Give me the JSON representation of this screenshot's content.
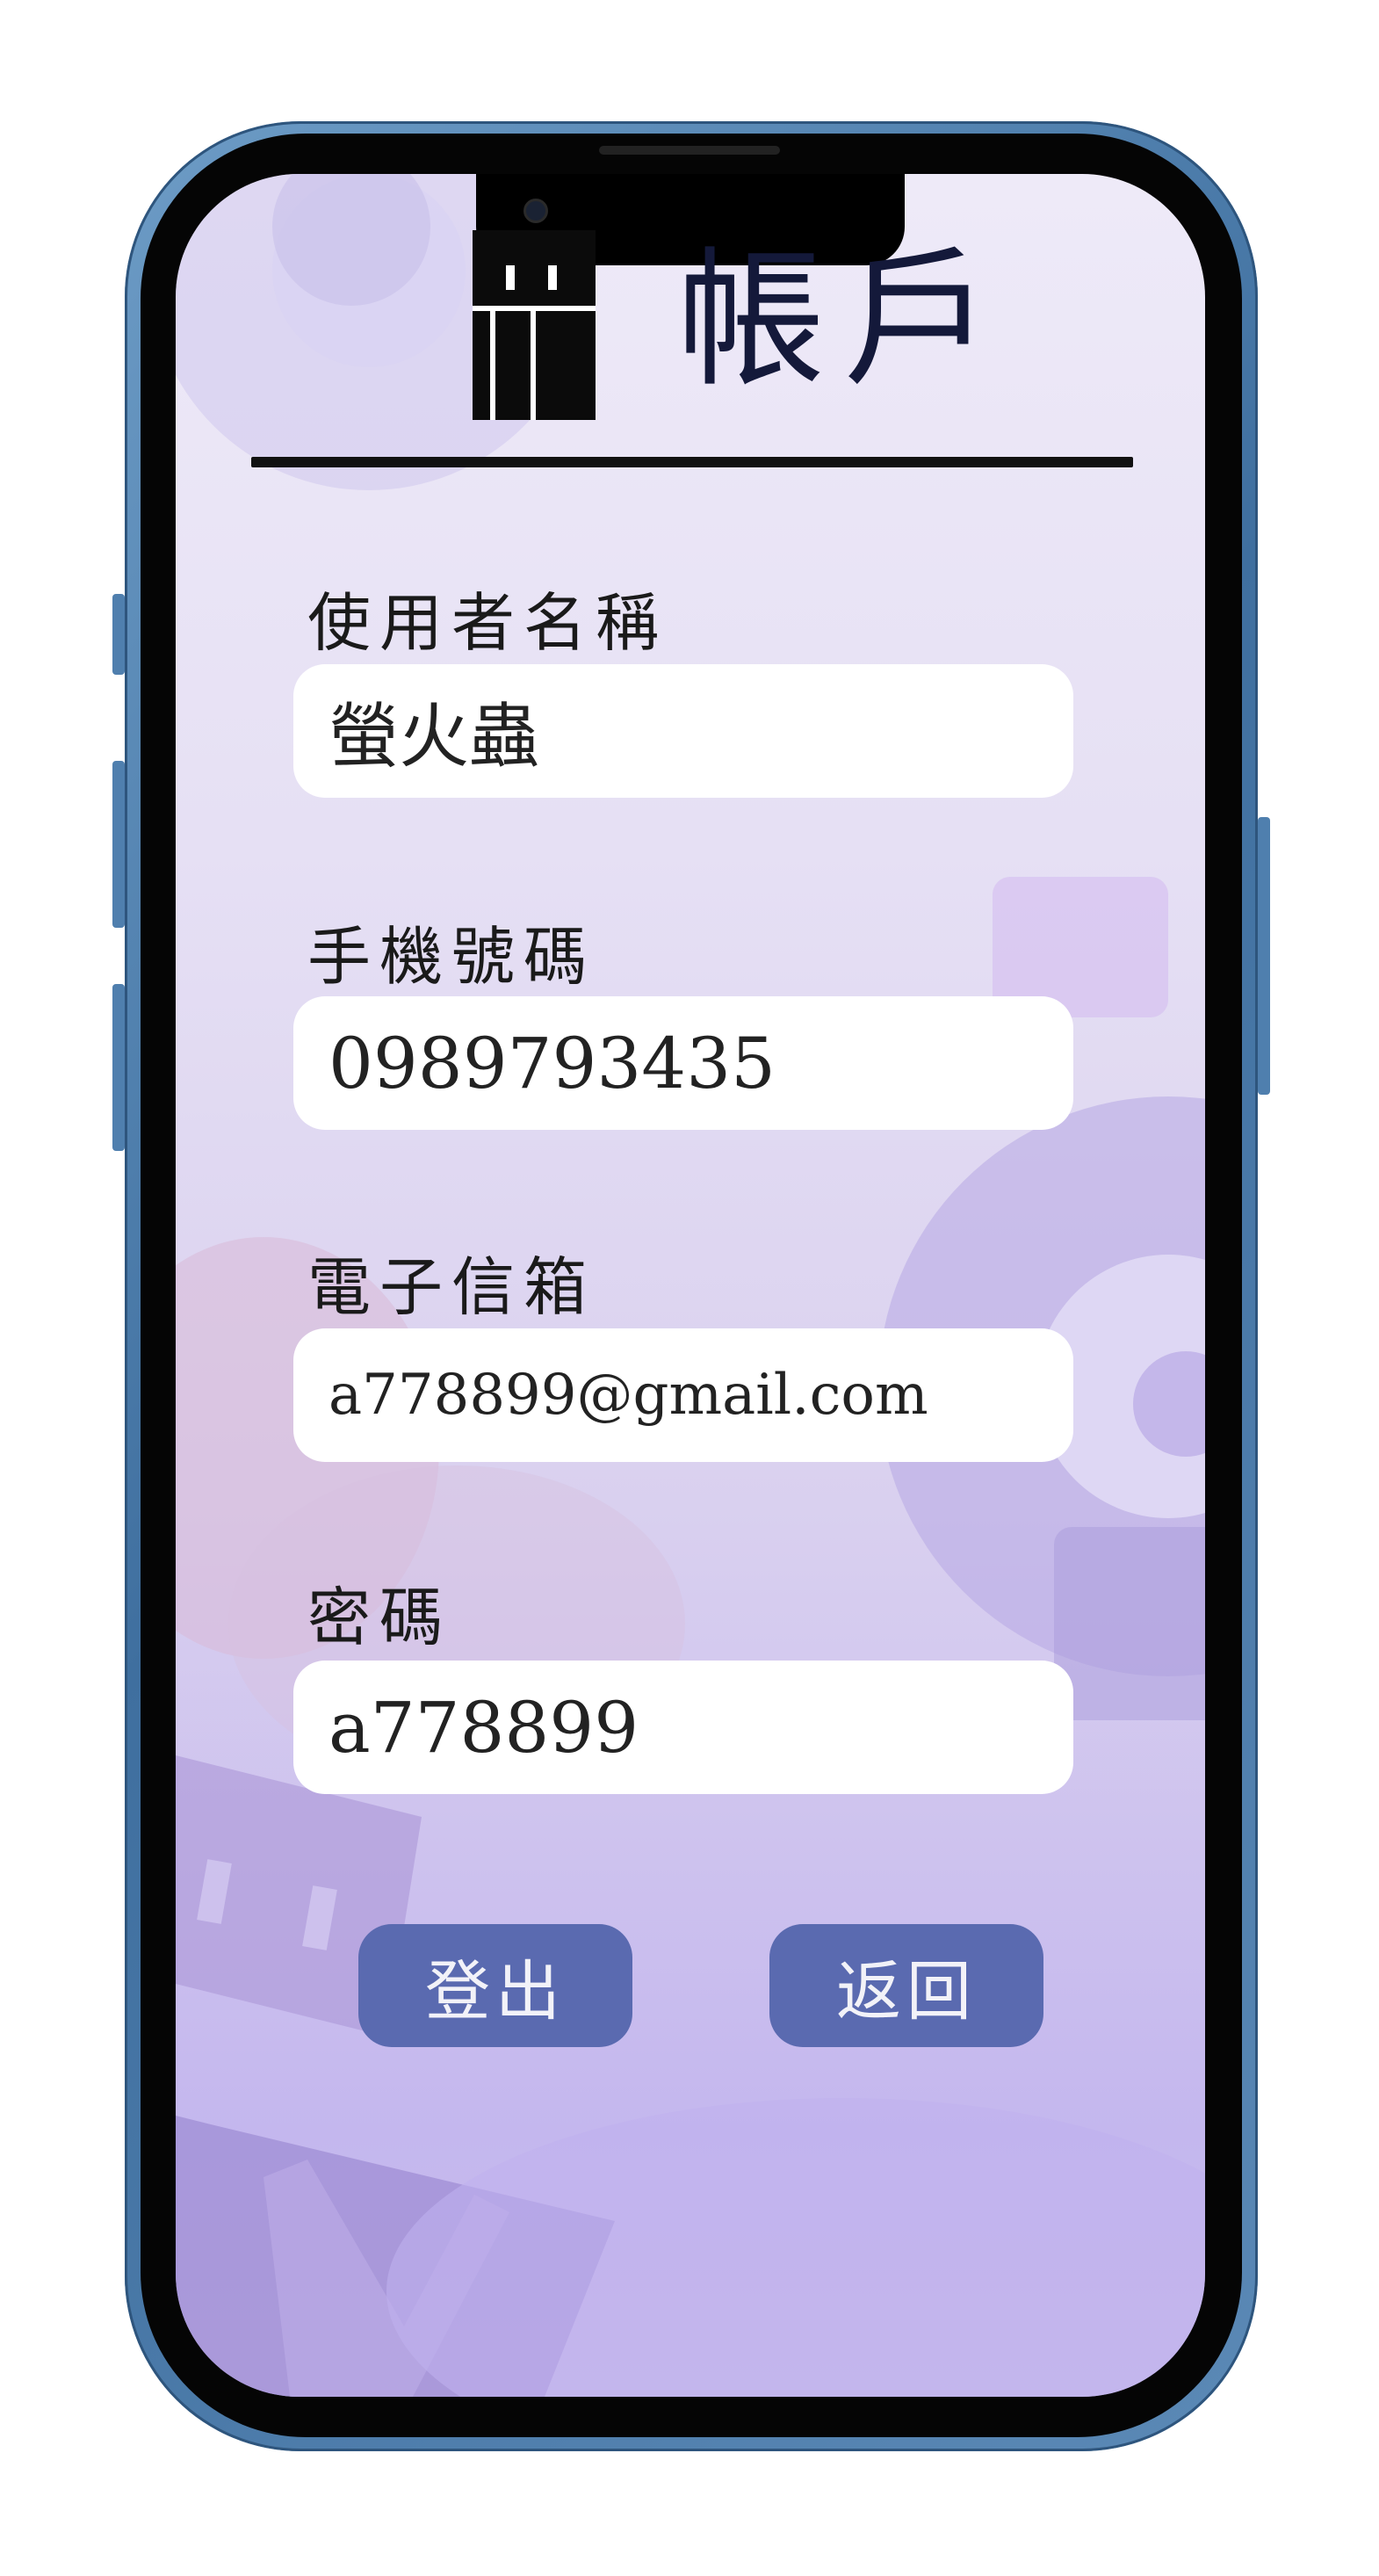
{
  "header": {
    "title": "帳戶"
  },
  "fields": [
    {
      "label": "使用者名稱",
      "value": "螢火蟲"
    },
    {
      "label": "手機號碼",
      "value": "0989793435"
    },
    {
      "label": "電子信箱",
      "value": "a778899@gmail.com"
    },
    {
      "label": "密碼",
      "value": "a778899"
    }
  ],
  "buttons": {
    "logout_label": "登出",
    "back_label": "返回"
  },
  "colors": {
    "button": "#5a6ab0",
    "title": "#14193a",
    "background_top": "#eeeaf8",
    "background_bottom": "#c4b7ee",
    "frame": "#4f7fae"
  }
}
